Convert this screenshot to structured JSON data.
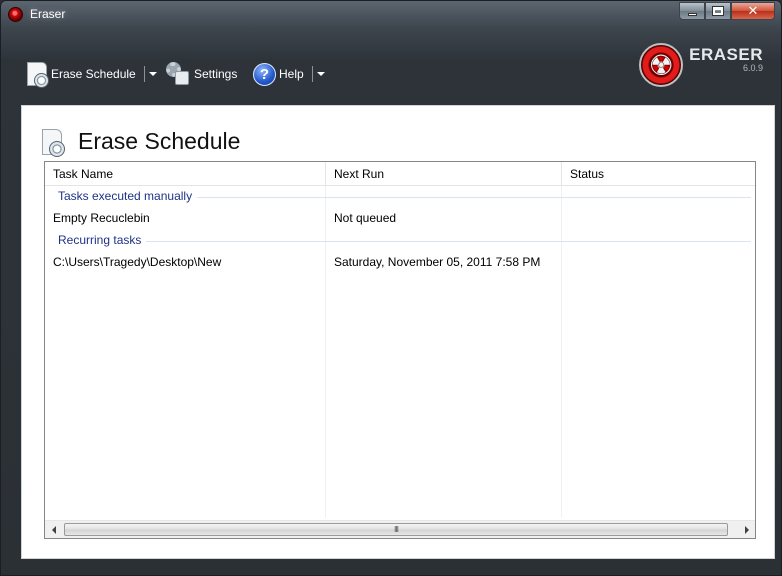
{
  "window": {
    "title": "Eraser"
  },
  "toolbar": {
    "erase_schedule_label": "Erase Schedule",
    "settings_label": "Settings",
    "help_label": "Help"
  },
  "brand": {
    "name": "ERASER",
    "version": "6.0.9"
  },
  "page": {
    "title": "Erase Schedule"
  },
  "table": {
    "columns": [
      "Task Name",
      "Next Run",
      "Status"
    ],
    "groups": [
      {
        "label": "Tasks executed manually",
        "rows": [
          {
            "task_name": "Empty Recuclebin",
            "next_run": "Not queued",
            "status": ""
          }
        ]
      },
      {
        "label": "Recurring tasks",
        "rows": [
          {
            "task_name": "C:\\Users\\Tragedy\\Desktop\\New",
            "next_run": "Saturday, November 05, 2011 7:58 PM",
            "status": ""
          }
        ]
      }
    ]
  },
  "scrollbar": {
    "grip": "III"
  },
  "icons": {
    "app": "eraser-logo-icon",
    "erase_schedule": "schedule-document-icon",
    "settings": "gear-icon",
    "help": "help-icon"
  },
  "colors": {
    "group_header": "#1e3287",
    "toolbar_background": "#2d3339",
    "panel_background": "#ffffff"
  }
}
